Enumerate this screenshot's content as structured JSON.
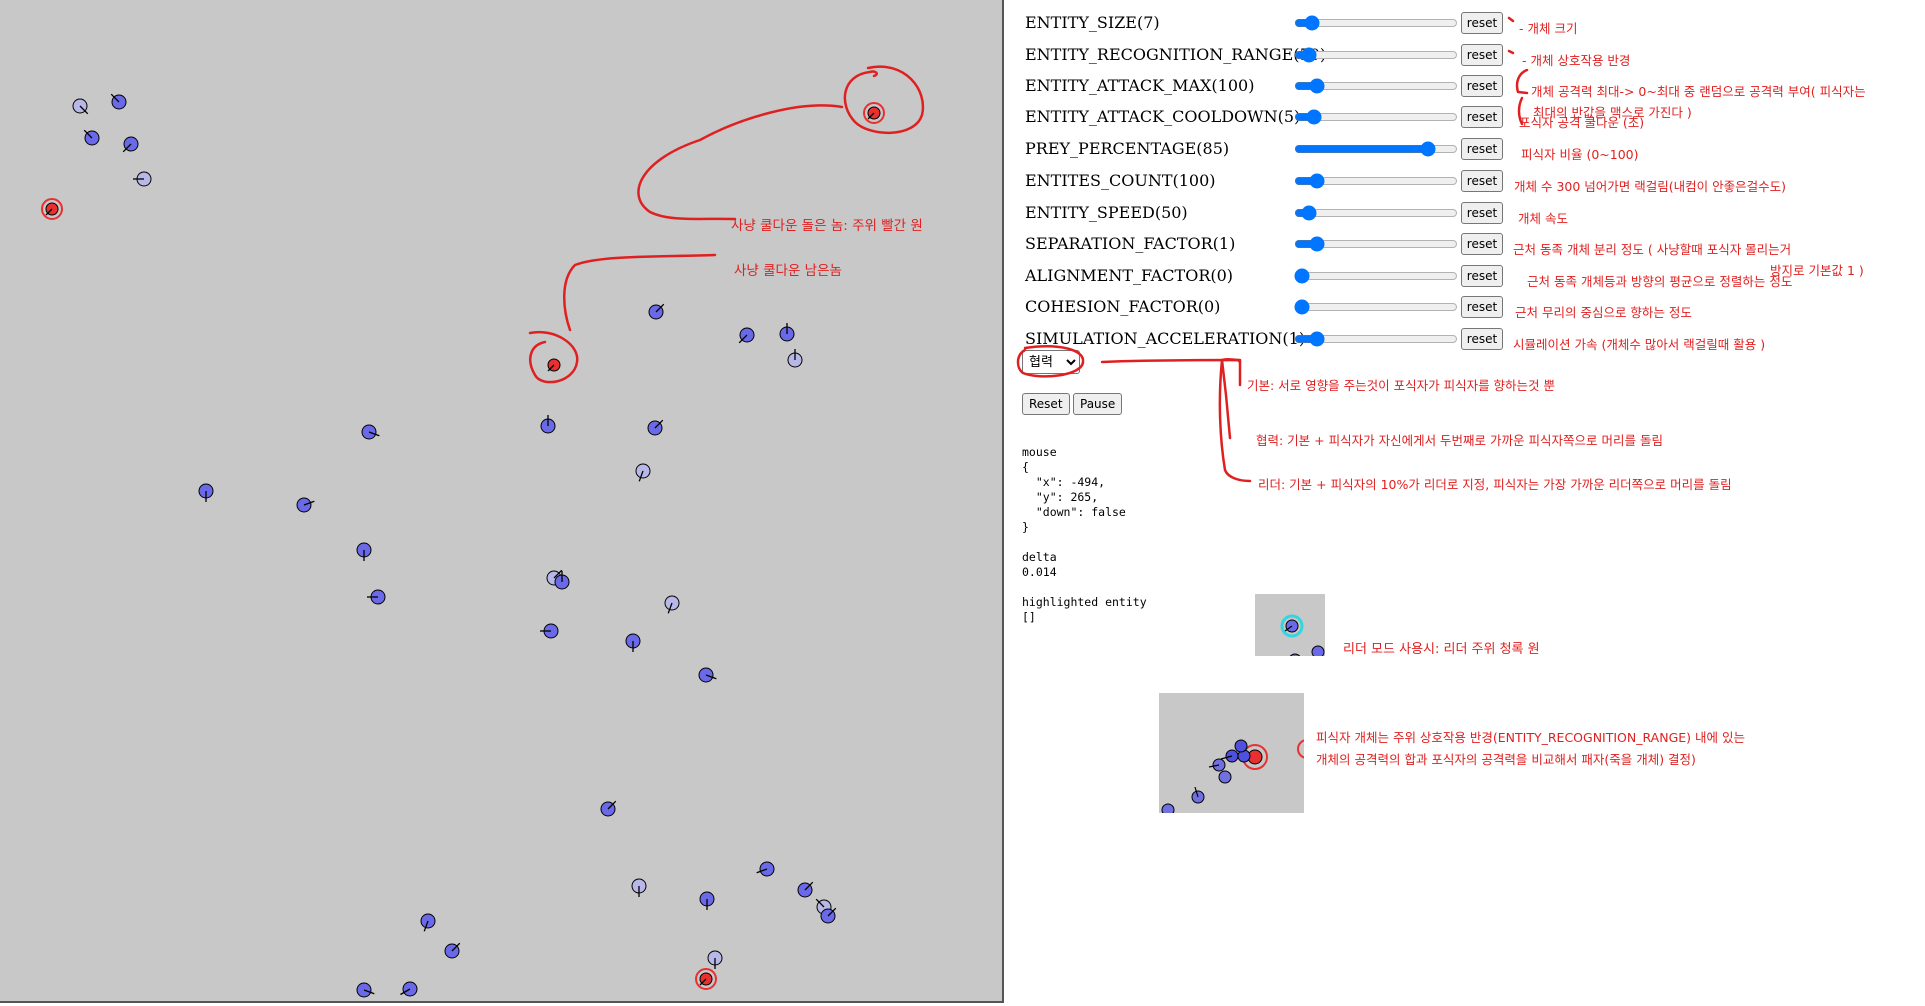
{
  "params": [
    {
      "label": "ENTITY_SIZE(7)",
      "value": 7,
      "max": 100,
      "reset_label": "reset",
      "note": "- 개체 크기"
    },
    {
      "label": "ENTITY_RECOGNITION_RANGE(50)",
      "value": 50,
      "max": 1000,
      "reset_label": "reset",
      "note": "- 개체 상호작용 반경"
    },
    {
      "label": "ENTITY_ATTACK_MAX(100)",
      "value": 100,
      "max": 1000,
      "reset_label": "reset",
      "note": "개체 공격력 최대-> 0~최대 중 랜덤으로 공격력 부여( 피식자는",
      "note2": "최대의 반값을 맥스로 가진다 )"
    },
    {
      "label": "ENTITY_ATTACK_COOLDOWN(5)",
      "value": 5,
      "max": 60,
      "reset_label": "reset",
      "note": "포식자 공격 쿨다운 (초)"
    },
    {
      "label": "PREY_PERCENTAGE(85)",
      "value": 85,
      "max": 100,
      "reset_label": "reset",
      "note": "피식자 비율 (0~100)"
    },
    {
      "label": "ENTITES_COUNT(100)",
      "value": 100,
      "max": 1000,
      "reset_label": "reset",
      "note": "개체 수 300 넘어가면 랙걸림(내컴이 안좋은걸수도)"
    },
    {
      "label": "ENTITY_SPEED(50)",
      "value": 50,
      "max": 1000,
      "reset_label": "reset",
      "note": "개체 속도"
    },
    {
      "label": "SEPARATION_FACTOR(1)",
      "value": 1,
      "max": 10,
      "reset_label": "reset",
      "note": "근처 동족 개체 분리 정도 ( 사냥할때 포식자 몰리는거",
      "note2": "방지로 기본값 1 )"
    },
    {
      "label": "ALIGNMENT_FACTOR(0)",
      "value": 0,
      "max": 10,
      "reset_label": "reset",
      "note": "근처 동족 개체등과 방향의 평균으로 정렬하는 정도"
    },
    {
      "label": "COHESION_FACTOR(0)",
      "value": 0,
      "max": 10,
      "reset_label": "reset",
      "note": "근처 무리의 중심으로 향하는 정도"
    },
    {
      "label": "SIMULATION_ACCELERATION(1)",
      "value": 1,
      "max": 10,
      "reset_label": "reset",
      "note": "시뮬레이션 가속 (개체수 많아서 랙걸릴때 활용 )"
    }
  ],
  "mode": {
    "selected": "협력",
    "notes": [
      "기본: 서로 영향을 주는것이 포식자가 피식자를 향하는것 뿐",
      "협력: 기본 + 피식자가 자신에게서 두번째로 가까운 피식자쪽으로 머리를 돌림",
      "리더: 기본 + 피식자의 10%가 리더로 지정, 피식자는 가장 가까운 리더쪽으로 머리를 돌림"
    ]
  },
  "controls": {
    "reset_label": "Reset",
    "pause_label": "Pause"
  },
  "debug": {
    "mouse_label": "mouse",
    "mouse_json": "{\n  \"x\": -494,\n  \"y\": 265,\n  \"down\": false\n}",
    "delta_label": "delta",
    "delta_value": "0.014",
    "highlight_label": "highlighted entity",
    "highlight_value": "[]"
  },
  "canvas_notes": {
    "cooldown_done": "사냥 쿨다운 돌은 놈: 주위 빨간 원",
    "cooldown_left": "사냥 쿨다운 남은놈"
  },
  "thumb_notes": {
    "leader": "리더 모드 사용시: 리더 주위 청록 원",
    "combat_1": "피식자 개체는 주위 상호작용 반경(ENTITY_RECOGNITION_RANGE) 내에 있는",
    "combat_2": "개체의 공격력의 합과 포식자의 공격력을 비교해서 패자(죽을 개체) 결정)"
  },
  "colors": {
    "canvas_bg": "#c8c8c8",
    "prey": "#6a6ae8",
    "prey_light": "#b8b8e8",
    "predator": "#e83030",
    "annotation": "#e02020",
    "leader_ring": "#33d6e0"
  }
}
